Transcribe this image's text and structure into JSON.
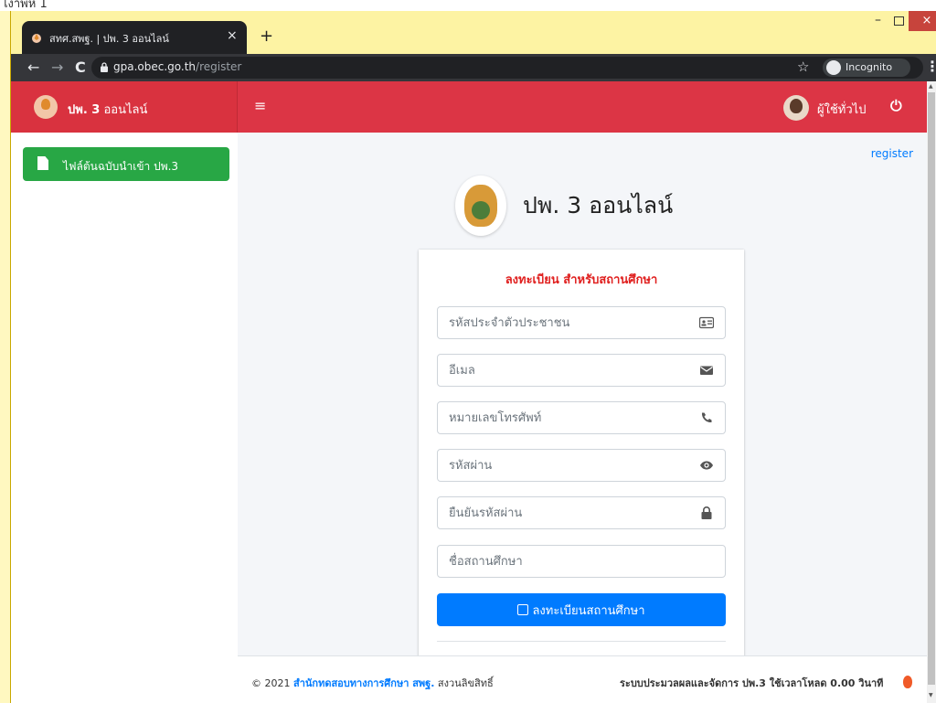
{
  "page_top_text": "ไงาพห 1",
  "browser": {
    "tab_title": "สทศ.สพฐ. | ปพ. 3 ออนไลน์",
    "tab_close": "×",
    "new_tab": "+",
    "url_host": "gpa.obec.go.th",
    "url_path": "/register",
    "incognito_label": "Incognito",
    "win_min": "–",
    "win_close": "×"
  },
  "header": {
    "brand_bold": "ปพ. 3",
    "brand_rest": " ออนไลน์",
    "hamburger": "≡",
    "user_name": "ผู้ใช้ทั่วไป",
    "power": "⏻"
  },
  "sidebar": {
    "items": [
      {
        "label": "ไฟล์ต้นฉบับนำเข้า ปพ.3"
      }
    ]
  },
  "main": {
    "breadcrumb": "register",
    "page_title": "ปพ. 3 ออนไลน์",
    "form": {
      "title": "ลงทะเบียน สำหรับสถานศึกษา",
      "fields": [
        {
          "placeholder": "รหัสประจำตัวประชาชน",
          "icon": "id-card-icon"
        },
        {
          "placeholder": "อีเมล",
          "icon": "envelope-icon"
        },
        {
          "placeholder": "หมายเลขโทรศัพท์",
          "icon": "phone-icon"
        },
        {
          "placeholder": "รหัสผ่าน",
          "icon": "eye-icon"
        },
        {
          "placeholder": "ยืนยันรหัสผ่าน",
          "icon": "lock-icon"
        },
        {
          "placeholder": "ชื่อสถานศึกษา",
          "icon": ""
        }
      ],
      "submit_label": "ลงทะเบียนสถานศึกษา"
    }
  },
  "footer": {
    "prefix": "© 2021 ",
    "org": "สำนักทดสอบทางการศึกษา สพฐ.",
    "suffix": " สงวนลิขสิทธิ์",
    "right": "ระบบประมวลผลและจัดการ ปพ.3 ใช้เวลาโหลด 0.00 วินาที"
  }
}
